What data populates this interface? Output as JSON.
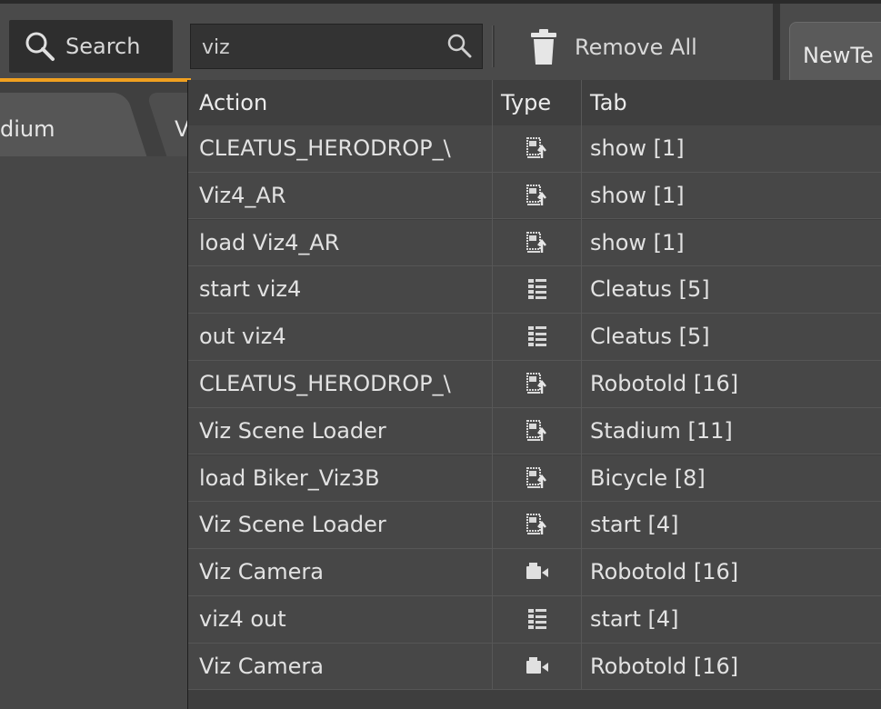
{
  "toolbar": {
    "search_button_label": "Search",
    "search_value": "viz",
    "remove_all_label": "Remove All",
    "new_tab_label": "NewTe"
  },
  "left_panel": {
    "tab_1_label": "dium",
    "tab_2_label": "V"
  },
  "colors": {
    "accent": "#f0a020",
    "background": "#3a3a3a",
    "row": "#474747"
  },
  "results": {
    "columns": [
      "Action",
      "Type",
      "Tab"
    ],
    "rows": [
      {
        "action": "CLEATUS_HERODROP_\\",
        "type": "scene-load-icon",
        "tab": "show [1]"
      },
      {
        "action": "Viz4_AR",
        "type": "scene-load-icon",
        "tab": "show [1]"
      },
      {
        "action": "load Viz4_AR",
        "type": "scene-load-icon",
        "tab": "show [1]"
      },
      {
        "action": "start viz4",
        "type": "sequence-icon",
        "tab": "Cleatus [5]"
      },
      {
        "action": "out viz4",
        "type": "sequence-icon",
        "tab": "Cleatus [5]"
      },
      {
        "action": "CLEATUS_HERODROP_\\",
        "type": "scene-load-icon",
        "tab": "Robotold [16]"
      },
      {
        "action": "Viz Scene Loader",
        "type": "scene-load-icon",
        "tab": "Stadium [11]"
      },
      {
        "action": "load Biker_Viz3B",
        "type": "scene-load-icon",
        "tab": "Bicycle [8]"
      },
      {
        "action": "Viz Scene Loader",
        "type": "scene-load-icon",
        "tab": "start [4]"
      },
      {
        "action": "Viz Camera",
        "type": "camera-icon",
        "tab": "Robotold [16]"
      },
      {
        "action": "viz4 out",
        "type": "sequence-icon",
        "tab": "start [4]"
      },
      {
        "action": "Viz Camera",
        "type": "camera-icon",
        "tab": "Robotold [16]"
      }
    ]
  }
}
